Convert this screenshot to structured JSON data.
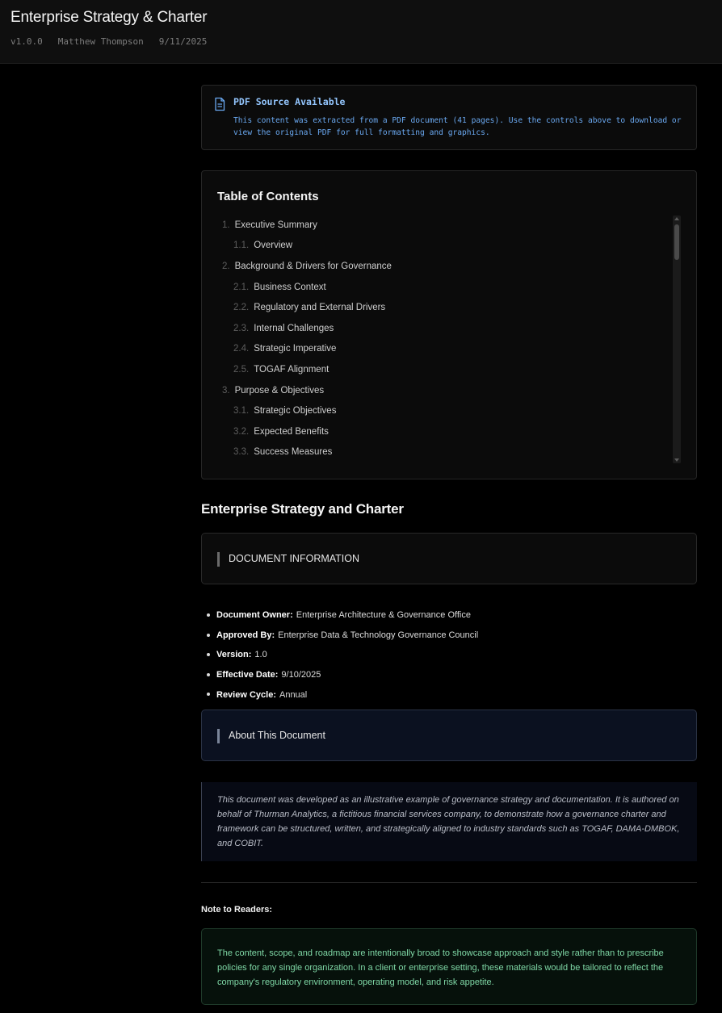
{
  "header": {
    "title": "Enterprise Strategy & Charter",
    "version": "v1.0.0",
    "author": "Matthew Thompson",
    "date": "9/11/2025"
  },
  "pdf_notice": {
    "icon": "document-icon",
    "title": "PDF Source Available",
    "text": "This content was extracted from a PDF document (41 pages). Use the controls above to download or view the original PDF for full formatting and graphics.",
    "color": "#93c5fd"
  },
  "toc": {
    "title": "Table of Contents",
    "items": [
      {
        "num": "1.",
        "label": "Executive Summary",
        "level": 1
      },
      {
        "num": "1.1.",
        "label": "Overview",
        "level": 2
      },
      {
        "num": "2.",
        "label": "Background & Drivers for Governance",
        "level": 1
      },
      {
        "num": "2.1.",
        "label": "Business Context",
        "level": 2
      },
      {
        "num": "2.2.",
        "label": "Regulatory and External Drivers",
        "level": 2
      },
      {
        "num": "2.3.",
        "label": "Internal Challenges",
        "level": 2
      },
      {
        "num": "2.4.",
        "label": "Strategic Imperative",
        "level": 2
      },
      {
        "num": "2.5.",
        "label": "TOGAF Alignment",
        "level": 2
      },
      {
        "num": "3.",
        "label": "Purpose & Objectives",
        "level": 1
      },
      {
        "num": "3.1.",
        "label": "Strategic Objectives",
        "level": 2
      },
      {
        "num": "3.2.",
        "label": "Expected Benefits",
        "level": 2
      },
      {
        "num": "3.3.",
        "label": "Success Measures",
        "level": 2
      }
    ]
  },
  "main": {
    "heading": "Enterprise Strategy and Charter",
    "doc_info_label": "DOCUMENT INFORMATION",
    "doc_info": [
      {
        "key": "Document Owner:",
        "value": "Enterprise Architecture & Governance Office"
      },
      {
        "key": "Approved By:",
        "value": "Enterprise Data & Technology Governance Council"
      },
      {
        "key": "Version:",
        "value": "1.0"
      },
      {
        "key": "Effective Date:",
        "value": "9/10/2025"
      },
      {
        "key": "Review Cycle:",
        "value": "Annual"
      }
    ],
    "about_label": "About This Document",
    "about_text": "This document was developed as an illustrative example of governance strategy and documentation. It is authored on behalf of Thurman Analytics, a fictitious financial services company, to demonstrate how a governance charter and framework can be structured, written, and strategically aligned to industry standards such as TOGAF, DAMA-DMBOK, and COBIT.",
    "note_title": "Note to Readers:",
    "note_text": "The content, scope, and roadmap are intentionally broad to showcase approach and style rather than to prescribe policies for any single organization. In a client or enterprise setting, these materials would be tailored to reflect the company's regulatory environment, operating model, and risk appetite.",
    "note_color": "#7fd8a6"
  }
}
